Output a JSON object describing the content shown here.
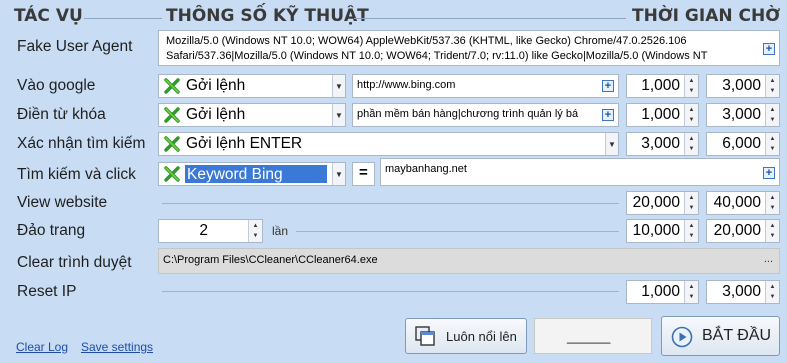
{
  "headers": {
    "task": "TÁC VỤ",
    "spec": "THÔNG SỐ KỸ THUẬT",
    "wait": "THỜI GIAN CHỜ"
  },
  "rows": {
    "user_agent": {
      "label": "Fake User Agent",
      "value_line1": "Mozilla/5.0 (Windows NT 10.0; WOW64) AppleWebKit/537.36 (KHTML, like Gecko) Chrome/47.0.2526.106",
      "value_line2": "Safari/537.36|Mozilla/5.0 (Windows NT 10.0; WOW64; Trident/7.0; rv:11.0) like Gecko|Mozilla/5.0 (Windows NT"
    },
    "google": {
      "label": "Vào google",
      "command": "Gởi lệnh",
      "param": "http://www.bing.com",
      "wait_min": "1,000",
      "wait_max": "3,000"
    },
    "keyword": {
      "label": "Điền từ khóa",
      "command": "Gởi lệnh",
      "param": "phần mềm bán hàng|chương trình quản lý bá",
      "wait_min": "1,000",
      "wait_max": "3,000"
    },
    "confirm": {
      "label": "Xác nhận tìm kiếm",
      "command": "Gởi lệnh ENTER",
      "wait_min": "3,000",
      "wait_max": "6,000"
    },
    "search_click": {
      "label": "Tìm kiếm và click",
      "command": "Keyword Bing",
      "operator": "=",
      "param": "maybanhang.net"
    },
    "view": {
      "label": "View website",
      "wait_min": "20,000",
      "wait_max": "40,000"
    },
    "pages": {
      "label": "Đảo trang",
      "count": "2",
      "unit": "lần",
      "wait_min": "10,000",
      "wait_max": "20,000"
    },
    "clear": {
      "label": "Clear trình duyệt",
      "path": "C:\\Program Files\\CCleaner\\CCleaner64.exe",
      "browse": "..."
    },
    "reset_ip": {
      "label": "Reset IP",
      "wait_min": "1,000",
      "wait_max": "3,000"
    }
  },
  "footer": {
    "clear_log": "Clear Log",
    "save_settings": "Save settings",
    "always_on_top": "Luôn nổi lên",
    "status_text": "______",
    "start": "BẮT ĐẦU"
  },
  "colors": {
    "background": "#c8dcf3",
    "selection": "#3a79d6",
    "link": "#1f4ea8"
  }
}
